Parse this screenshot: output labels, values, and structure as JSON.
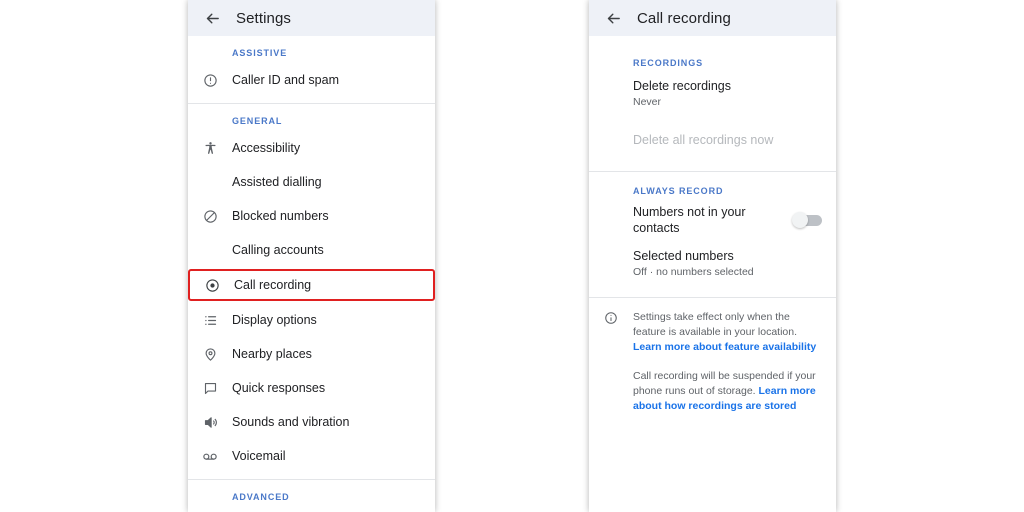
{
  "colors": {
    "accent_blue": "#4a78c8",
    "link_blue": "#1a73e8",
    "highlight_red": "#e02020",
    "appbar_bg": "#eef1f7",
    "text_primary": "#202124",
    "text_secondary": "#5f6368",
    "disabled": "#b5b8bc"
  },
  "settings_screen": {
    "back_icon": "arrow-back-icon",
    "title": "Settings",
    "sections": [
      {
        "label": "ASSISTIVE",
        "items": [
          {
            "icon": "error-circle-icon",
            "label": "Caller ID and spam"
          }
        ]
      },
      {
        "label": "GENERAL",
        "items": [
          {
            "icon": "accessibility-icon",
            "label": "Accessibility"
          },
          {
            "icon": "none",
            "label": "Assisted dialling"
          },
          {
            "icon": "block-icon",
            "label": "Blocked numbers"
          },
          {
            "icon": "none",
            "label": "Calling accounts"
          },
          {
            "icon": "record-icon",
            "label": "Call recording",
            "highlighted": true
          },
          {
            "icon": "list-icon",
            "label": "Display options"
          },
          {
            "icon": "place-pin-icon",
            "label": "Nearby places"
          },
          {
            "icon": "chat-bubble-icon",
            "label": "Quick responses"
          },
          {
            "icon": "volume-icon",
            "label": "Sounds and vibration"
          },
          {
            "icon": "voicemail-icon",
            "label": "Voicemail"
          }
        ]
      },
      {
        "label": "ADVANCED",
        "items": []
      }
    ]
  },
  "call_recording_screen": {
    "back_icon": "arrow-back-icon",
    "title": "Call recording",
    "sections": [
      {
        "label": "RECORDINGS",
        "items": [
          {
            "label": "Delete recordings",
            "sub": "Never",
            "disabled": false
          },
          {
            "label": "Delete all recordings now",
            "sub": "",
            "disabled": true
          }
        ]
      },
      {
        "label": "ALWAYS RECORD",
        "items": [
          {
            "label": "Numbers not in your contacts",
            "sub": "",
            "disabled": false,
            "toggle": "off"
          },
          {
            "label": "Selected numbers",
            "sub": "Off · no numbers selected",
            "disabled": false
          }
        ]
      }
    ],
    "footer": {
      "icon": "info-circle-icon",
      "paragraphs": [
        {
          "text": "Settings take effect only when the feature is available in your location. ",
          "link": "Learn more about feature availability"
        },
        {
          "text": "Call recording will be suspended if your phone runs out of storage. ",
          "link": "Learn more about how recordings are stored"
        }
      ]
    }
  }
}
